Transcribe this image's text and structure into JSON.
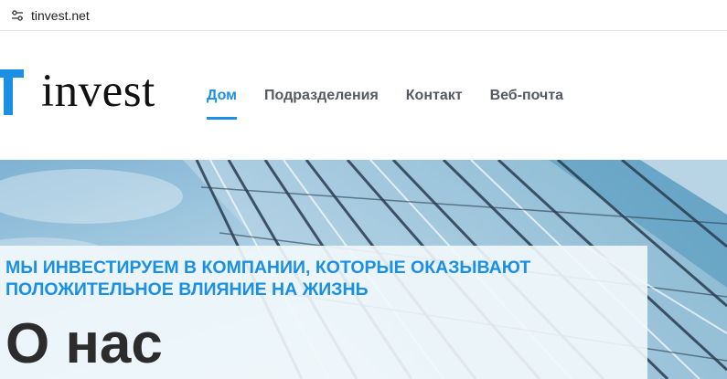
{
  "browser": {
    "url": "tinvest.net",
    "site_info_icon": "tune-icon"
  },
  "header": {
    "logo": {
      "mark_letter": "T",
      "text": "invest",
      "accent": "#1a8fe3"
    },
    "nav": [
      {
        "label": "Дом",
        "active": true
      },
      {
        "label": "Подразделения",
        "active": false
      },
      {
        "label": "Контакт",
        "active": false
      },
      {
        "label": "Веб-почта",
        "active": false
      }
    ]
  },
  "hero": {
    "subtitle": "МЫ ИНВЕСТИРУЕМ В КОМПАНИИ, КОТОРЫЕ ОКАЗЫВАЮТ ПОЛОЖИТЕЛЬНОЕ ВЛИЯНИЕ НА ЖИЗНЬ",
    "title": "О нас"
  },
  "colors": {
    "accent": "#1a8fe3",
    "nav_text": "#555a60",
    "title_text": "#2c2c2c"
  }
}
